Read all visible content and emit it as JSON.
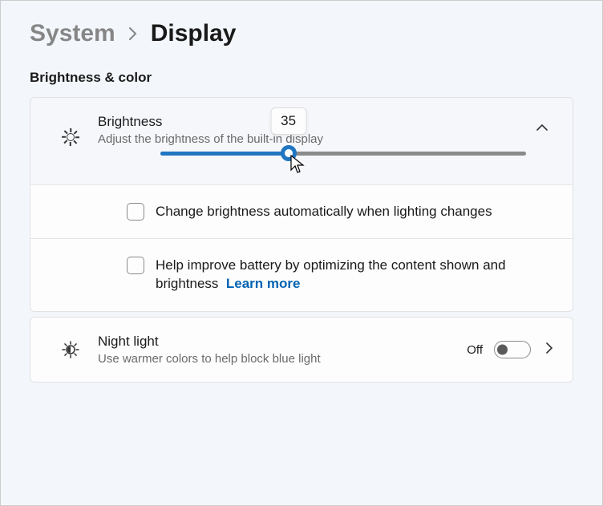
{
  "breadcrumb": {
    "parent": "System",
    "current": "Display"
  },
  "section": {
    "heading": "Brightness & color"
  },
  "brightness": {
    "title": "Brightness",
    "description": "Adjust the brightness of the built-in display",
    "value": 35,
    "tooltip": "35",
    "expanded": true,
    "auto": {
      "label": "Change brightness automatically when lighting changes",
      "checked": false
    },
    "optimize": {
      "label": "Help improve battery by optimizing the content shown and brightness",
      "learn_more": "Learn more",
      "checked": false
    }
  },
  "night_light": {
    "title": "Night light",
    "description": "Use warmer colors to help block blue light",
    "state_label": "Off",
    "enabled": false
  }
}
